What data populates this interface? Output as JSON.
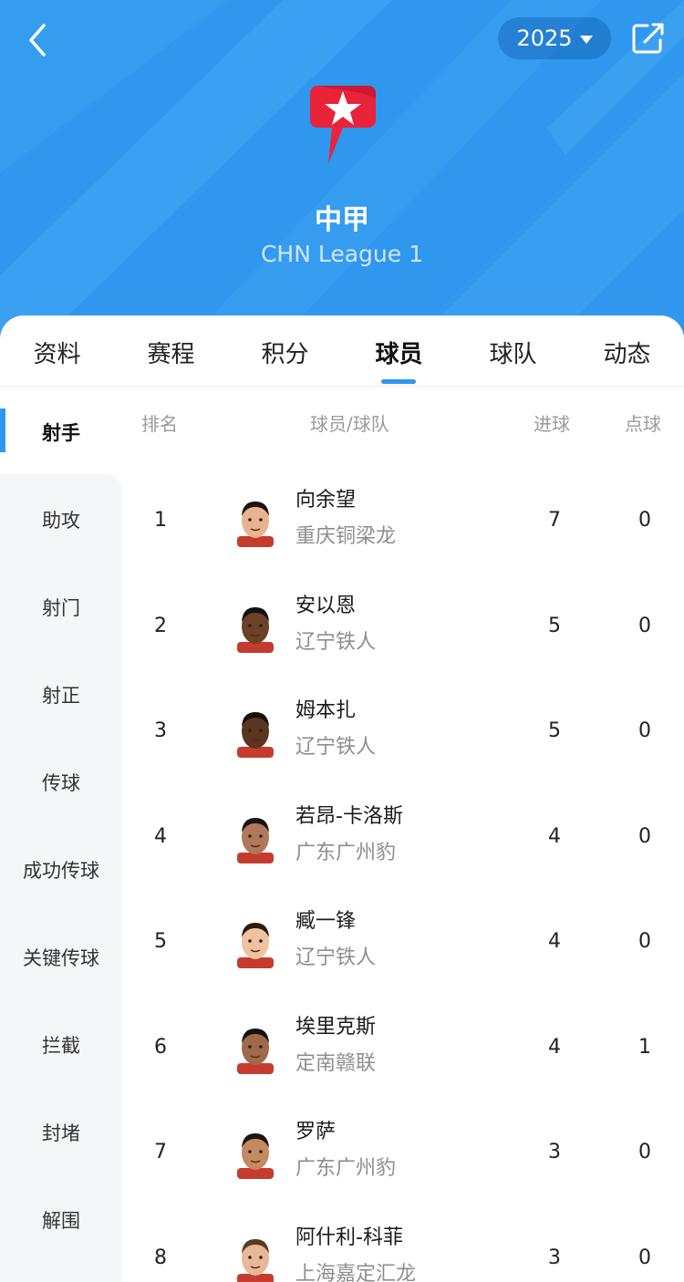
{
  "header": {
    "season": "2025",
    "league_name": "中甲",
    "league_name_en": "CHN League 1",
    "brand_color": "#2f97ee",
    "icons": {
      "back": "chevron-left-icon",
      "season_dropdown": "caret-down-icon",
      "share": "share-icon",
      "logo": "league-logo-icon"
    }
  },
  "tabs": [
    {
      "label": "资料",
      "active": false
    },
    {
      "label": "赛程",
      "active": false
    },
    {
      "label": "积分",
      "active": false
    },
    {
      "label": "球员",
      "active": true
    },
    {
      "label": "球队",
      "active": false
    },
    {
      "label": "动态",
      "active": false
    }
  ],
  "sidebar": {
    "items": [
      {
        "label": "射手",
        "active": true
      },
      {
        "label": "助攻",
        "active": false
      },
      {
        "label": "射门",
        "active": false
      },
      {
        "label": "射正",
        "active": false
      },
      {
        "label": "传球",
        "active": false
      },
      {
        "label": "成功传球",
        "active": false
      },
      {
        "label": "关键传球",
        "active": false
      },
      {
        "label": "拦截",
        "active": false
      },
      {
        "label": "封堵",
        "active": false
      },
      {
        "label": "解围",
        "active": false
      }
    ]
  },
  "table": {
    "headers": {
      "rank": "排名",
      "player_team": "球员/球队",
      "goals": "进球",
      "penalties": "点球"
    },
    "rows": [
      {
        "rank": "1",
        "name": "向余望",
        "team": "重庆铜梁龙",
        "goals": "7",
        "penalties": "0"
      },
      {
        "rank": "2",
        "name": "安以恩",
        "team": "辽宁铁人",
        "goals": "5",
        "penalties": "0"
      },
      {
        "rank": "3",
        "name": "姆本扎",
        "team": "辽宁铁人",
        "goals": "5",
        "penalties": "0"
      },
      {
        "rank": "4",
        "name": "若昂-卡洛斯",
        "team": "广东广州豹",
        "goals": "4",
        "penalties": "0"
      },
      {
        "rank": "5",
        "name": "臧一锋",
        "team": "辽宁铁人",
        "goals": "4",
        "penalties": "0"
      },
      {
        "rank": "6",
        "name": "埃里克斯",
        "team": "定南赣联",
        "goals": "4",
        "penalties": "1"
      },
      {
        "rank": "7",
        "name": "罗萨",
        "team": "广东广州豹",
        "goals": "3",
        "penalties": "0"
      },
      {
        "rank": "8",
        "name": "阿什利-科菲",
        "team": "上海嘉定汇龙",
        "goals": "3",
        "penalties": "0"
      }
    ]
  }
}
